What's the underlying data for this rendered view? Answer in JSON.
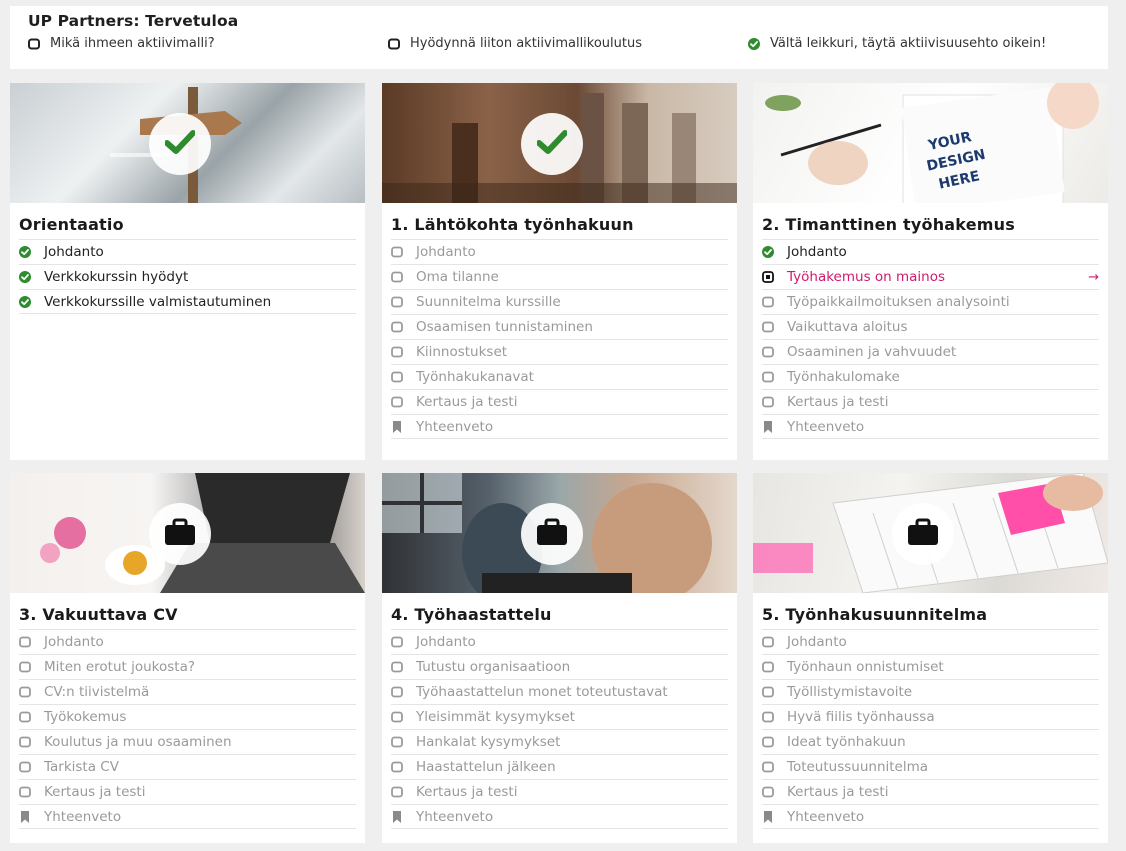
{
  "header": {
    "title": "UP Partners: Tervetuloa",
    "links": [
      {
        "label": "Mikä ihmeen aktiivimalli?",
        "status": "open"
      },
      {
        "label": "Hyödynnä liiton aktiivimallikoulutus",
        "status": "open"
      },
      {
        "label": "Vältä leikkuri, täytä aktiivisuusehto oikein!",
        "status": "done"
      }
    ]
  },
  "colors": {
    "done": "#2e8b2e",
    "active": "#d11a6e",
    "muted": "#9a9a9a",
    "text": "#222222"
  },
  "cards": [
    {
      "title": "Orientaatio",
      "badge": "check-icon",
      "items": [
        {
          "label": "Johdanto",
          "status": "done"
        },
        {
          "label": "Verkkokurssin hyödyt",
          "status": "done"
        },
        {
          "label": "Verkkokurssille valmistautuminen",
          "status": "done"
        }
      ]
    },
    {
      "title": "1. Lähtökohta työnhakuun",
      "badge": "check-icon",
      "items": [
        {
          "label": "Johdanto",
          "status": "open"
        },
        {
          "label": "Oma tilanne",
          "status": "open"
        },
        {
          "label": "Suunnitelma kurssille",
          "status": "open"
        },
        {
          "label": "Osaamisen tunnistaminen",
          "status": "open"
        },
        {
          "label": "Kiinnostukset",
          "status": "open"
        },
        {
          "label": "Työnhakukanavat",
          "status": "open"
        },
        {
          "label": "Kertaus ja testi",
          "status": "open"
        },
        {
          "label": "Yhteenveto",
          "status": "summary"
        }
      ]
    },
    {
      "title": "2. Timanttinen työhakemus",
      "badge": "",
      "banner_text": "YOUR DESIGN HERE",
      "items": [
        {
          "label": "Johdanto",
          "status": "done"
        },
        {
          "label": "Työhakemus on mainos",
          "status": "active"
        },
        {
          "label": "Työpaikkailmoituksen analysointi",
          "status": "open"
        },
        {
          "label": "Vaikuttava aloitus",
          "status": "open"
        },
        {
          "label": "Osaaminen ja vahvuudet",
          "status": "open"
        },
        {
          "label": "Työnhakulomake",
          "status": "open"
        },
        {
          "label": "Kertaus ja testi",
          "status": "open"
        },
        {
          "label": "Yhteenveto",
          "status": "summary"
        }
      ]
    },
    {
      "title": "3. Vakuuttava CV",
      "badge": "lock-icon",
      "items": [
        {
          "label": "Johdanto",
          "status": "open"
        },
        {
          "label": "Miten erotut joukosta?",
          "status": "open"
        },
        {
          "label": "CV:n tiivistelmä",
          "status": "open"
        },
        {
          "label": "Työkokemus",
          "status": "open"
        },
        {
          "label": "Koulutus ja muu osaaminen",
          "status": "open"
        },
        {
          "label": "Tarkista CV",
          "status": "open"
        },
        {
          "label": "Kertaus ja testi",
          "status": "open"
        },
        {
          "label": "Yhteenveto",
          "status": "summary"
        }
      ]
    },
    {
      "title": "4. Työhaastattelu",
      "badge": "lock-icon",
      "items": [
        {
          "label": "Johdanto",
          "status": "open"
        },
        {
          "label": "Tutustu organisaatioon",
          "status": "open"
        },
        {
          "label": "Työhaastattelun monet toteutustavat",
          "status": "open"
        },
        {
          "label": "Yleisimmät kysymykset",
          "status": "open"
        },
        {
          "label": "Hankalat kysymykset",
          "status": "open"
        },
        {
          "label": "Haastattelun jälkeen",
          "status": "open"
        },
        {
          "label": "Kertaus ja testi",
          "status": "open"
        },
        {
          "label": "Yhteenveto",
          "status": "summary"
        }
      ]
    },
    {
      "title": "5. Työnhakusuunnitelma",
      "badge": "lock-icon",
      "items": [
        {
          "label": "Johdanto",
          "status": "open"
        },
        {
          "label": "Työnhaun onnistumiset",
          "status": "open"
        },
        {
          "label": "Työllistymistavoite",
          "status": "open"
        },
        {
          "label": "Hyvä fiilis työnhaussa",
          "status": "open"
        },
        {
          "label": "Ideat työnhakuun",
          "status": "open"
        },
        {
          "label": "Toteutussuunnitelma",
          "status": "open"
        },
        {
          "label": "Kertaus ja testi",
          "status": "open"
        },
        {
          "label": "Yhteenveto",
          "status": "summary"
        }
      ]
    }
  ]
}
